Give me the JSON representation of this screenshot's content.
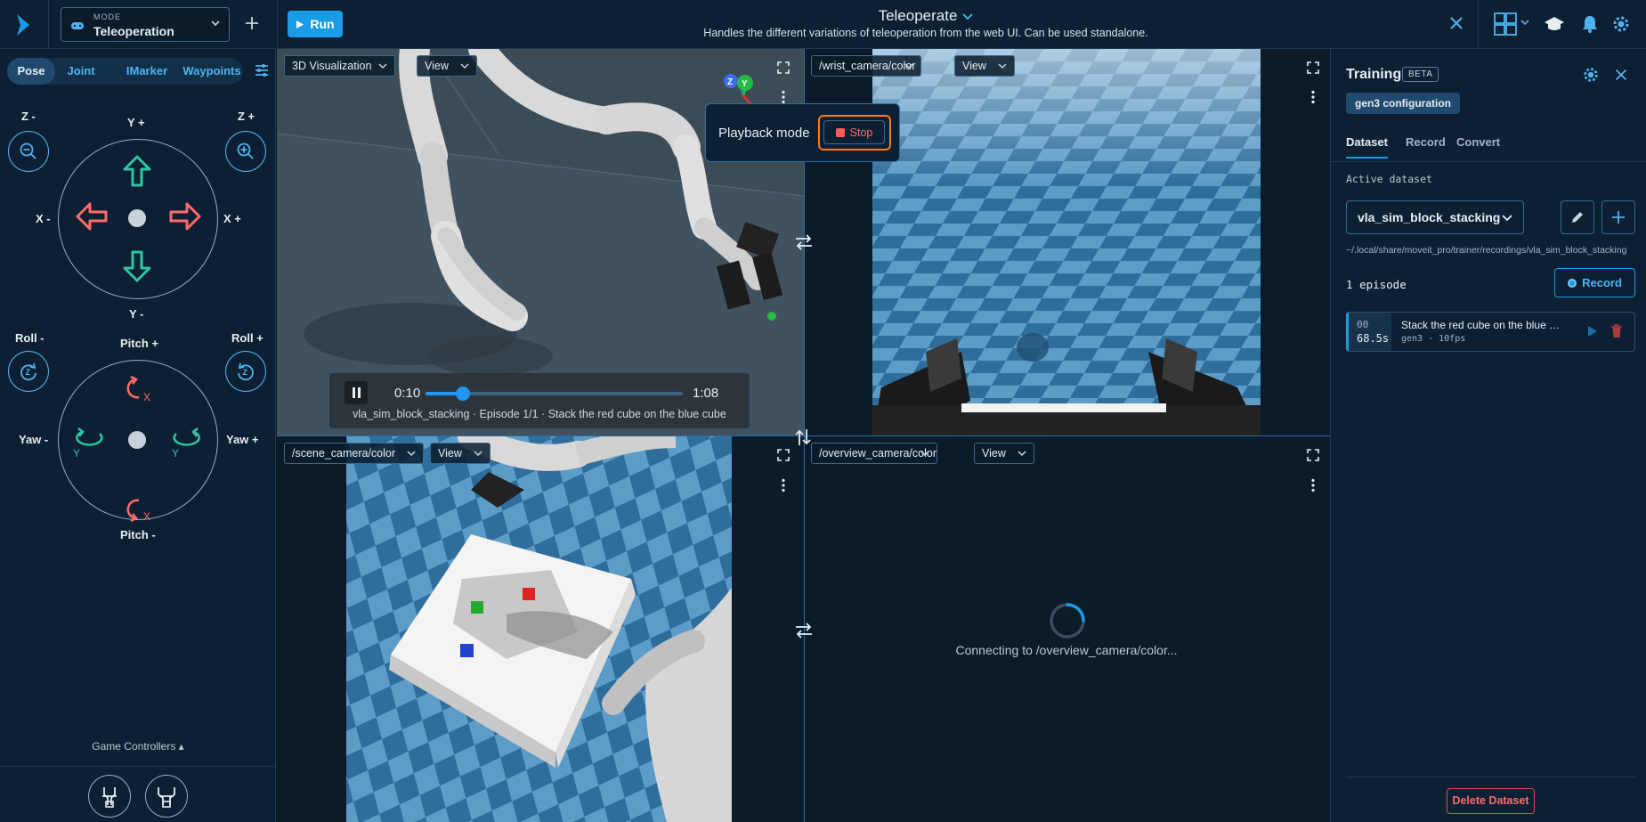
{
  "header": {
    "mode_caption": "MODE",
    "mode_value": "Teleoperation",
    "run_label": "Run",
    "title": "Teleoperate",
    "subtitle": "Handles the different variations of teleoperation from the web UI. Can be used standalone."
  },
  "left": {
    "tabs": [
      {
        "label": "Pose",
        "active": true
      },
      {
        "label": "Joint",
        "active": false
      },
      {
        "label": "IMarker",
        "active": false
      },
      {
        "label": "Waypoints",
        "active": false
      }
    ],
    "translate": {
      "z_minus": "Z -",
      "z_plus": "Z +",
      "y_plus": "Y +",
      "y_minus": "Y -",
      "x_minus": "X -",
      "x_plus": "X +"
    },
    "rotate": {
      "roll_minus": "Roll -",
      "roll_plus": "Roll +",
      "pitch_plus": "Pitch +",
      "pitch_minus": "Pitch -",
      "yaw_minus": "Yaw -",
      "yaw_plus": "Yaw +",
      "axis_x": "X",
      "axis_y": "Y",
      "axis_z": "Z"
    },
    "game_controllers": "Game Controllers ▴"
  },
  "viewports": {
    "tl": {
      "source": "3D Visualization",
      "view": "View"
    },
    "tr": {
      "source": "/wrist_camera/color",
      "view": "View"
    },
    "bl": {
      "source": "/scene_camera/color",
      "view": "View"
    },
    "br": {
      "source": "/overview_camera/color",
      "view": "View",
      "status": "Connecting to /overview_camera/color..."
    }
  },
  "axes_gizmo": {
    "z": "Z",
    "y": "Y",
    "x": "X"
  },
  "playback": {
    "label": "Playback mode",
    "stop_label": "Stop"
  },
  "player": {
    "current": "0:10",
    "total": "1:08",
    "progress_fraction": 0.147,
    "caption": "vla_sim_block_stacking · Episode 1/1 · Stack the red cube on the blue cube"
  },
  "training": {
    "title": "Training",
    "beta": "BETA",
    "config_chip": "gen3 configuration",
    "tabs": [
      {
        "label": "Dataset",
        "active": true
      },
      {
        "label": "Record",
        "active": false
      },
      {
        "label": "Convert",
        "active": false
      }
    ],
    "active_dataset_label": "Active dataset",
    "dataset": "vla_sim_block_stacking",
    "path": "~/.local/share/moveit_pro/trainer/recordings/vla_sim_block_stacking",
    "episode_count": "1 episode",
    "record_label": "Record",
    "episodes": [
      {
        "index": "00",
        "duration": "68.5s",
        "title": "Stack the red cube on the blue c…",
        "meta": "gen3 · 10fps"
      }
    ],
    "delete_label": "Delete Dataset"
  },
  "colors": {
    "accent": "#1a9be6",
    "teal_arrow": "#2ec4a6",
    "red_arrow": "#ff6b6b",
    "highlight": "#ff7a1a",
    "background": "#0b1b2a"
  }
}
